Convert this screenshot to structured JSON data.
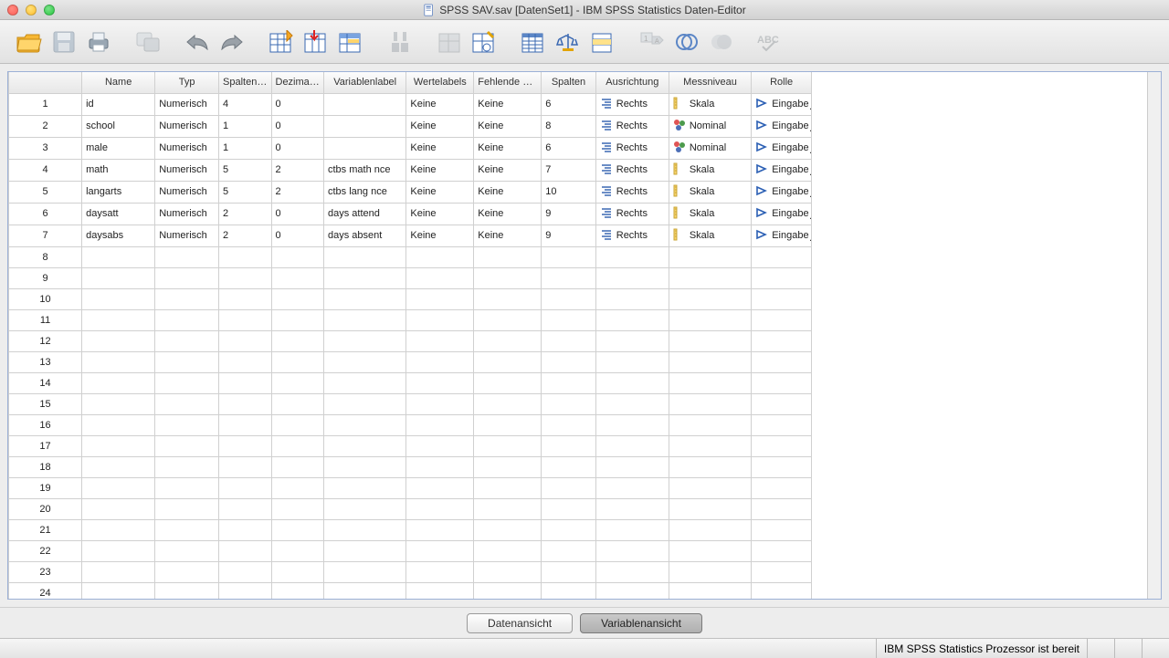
{
  "window": {
    "title": "SPSS SAV.sav [DatenSet1] - IBM SPSS Statistics Daten-Editor"
  },
  "columns": {
    "name": "Name",
    "type": "Typ",
    "width": "Spaltenf...",
    "decimals": "Dezimal...",
    "label": "Variablenlabel",
    "values": "Wertelabels",
    "missing": "Fehlende W...",
    "cols": "Spalten",
    "align": "Ausrichtung",
    "measure": "Messniveau",
    "role": "Rolle"
  },
  "rows": [
    {
      "num": "1",
      "name": "id",
      "type": "Numerisch",
      "width": "4",
      "decimals": "0",
      "label": "",
      "values": "Keine",
      "missing": "Keine",
      "cols": "6",
      "align": "Rechts",
      "measure": "Skala",
      "measure_kind": "scale",
      "role": "Eingabe"
    },
    {
      "num": "2",
      "name": "school",
      "type": "Numerisch",
      "width": "1",
      "decimals": "0",
      "label": "",
      "values": "Keine",
      "missing": "Keine",
      "cols": "8",
      "align": "Rechts",
      "measure": "Nominal",
      "measure_kind": "nominal",
      "role": "Eingabe"
    },
    {
      "num": "3",
      "name": "male",
      "type": "Numerisch",
      "width": "1",
      "decimals": "0",
      "label": "",
      "values": "Keine",
      "missing": "Keine",
      "cols": "6",
      "align": "Rechts",
      "measure": "Nominal",
      "measure_kind": "nominal",
      "role": "Eingabe"
    },
    {
      "num": "4",
      "name": "math",
      "type": "Numerisch",
      "width": "5",
      "decimals": "2",
      "label": "ctbs math nce",
      "values": "Keine",
      "missing": "Keine",
      "cols": "7",
      "align": "Rechts",
      "measure": "Skala",
      "measure_kind": "scale",
      "role": "Eingabe"
    },
    {
      "num": "5",
      "name": "langarts",
      "type": "Numerisch",
      "width": "5",
      "decimals": "2",
      "label": "ctbs lang nce",
      "values": "Keine",
      "missing": "Keine",
      "cols": "10",
      "align": "Rechts",
      "measure": "Skala",
      "measure_kind": "scale",
      "role": "Eingabe"
    },
    {
      "num": "6",
      "name": "daysatt",
      "type": "Numerisch",
      "width": "2",
      "decimals": "0",
      "label": "days attend",
      "values": "Keine",
      "missing": "Keine",
      "cols": "9",
      "align": "Rechts",
      "measure": "Skala",
      "measure_kind": "scale",
      "role": "Eingabe"
    },
    {
      "num": "7",
      "name": "daysabs",
      "type": "Numerisch",
      "width": "2",
      "decimals": "0",
      "label": "days absent",
      "values": "Keine",
      "missing": "Keine",
      "cols": "9",
      "align": "Rechts",
      "measure": "Skala",
      "measure_kind": "scale",
      "role": "Eingabe"
    }
  ],
  "empty_rows": [
    "8",
    "9",
    "10",
    "11",
    "12",
    "13",
    "14",
    "15",
    "16",
    "17",
    "18",
    "19",
    "20",
    "21",
    "22",
    "23",
    "24"
  ],
  "tabs": {
    "data_view": "Datenansicht",
    "variable_view": "Variablenansicht"
  },
  "status": {
    "text": "IBM SPSS Statistics  Prozessor ist bereit"
  },
  "col_widths": {
    "rownum": 78,
    "name": 78,
    "type": 68,
    "width": 56,
    "decimals": 56,
    "label": 88,
    "values": 72,
    "missing": 72,
    "cols": 58,
    "align": 78,
    "measure": 88,
    "role": 64
  }
}
